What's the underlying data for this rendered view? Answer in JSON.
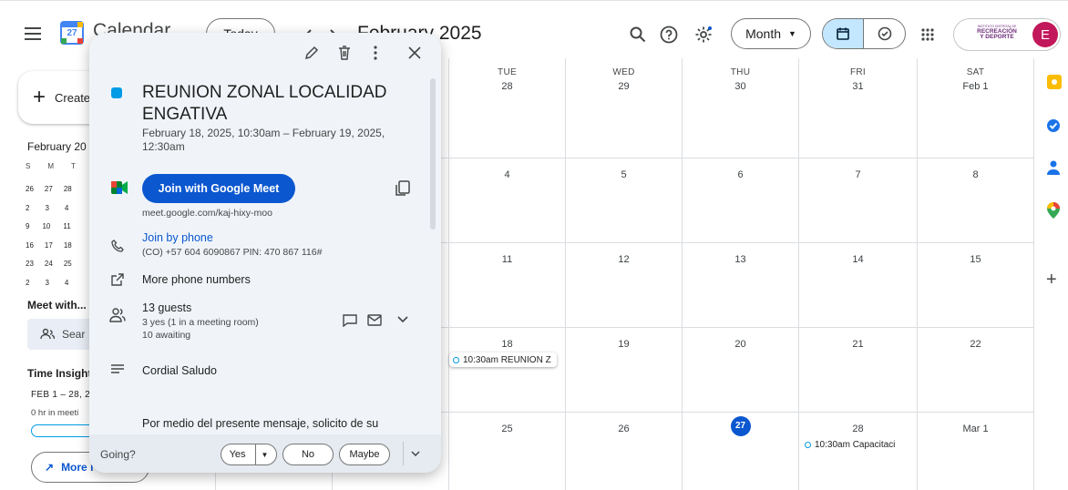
{
  "app": {
    "name": "Calendar",
    "logo_day": "27"
  },
  "header": {
    "today_label": "Today",
    "period_title": "February 2025",
    "view_select": "Month",
    "org_logo_text": [
      "INSTITUTO DISTRITAL DE",
      "RECREACIÓN",
      "Y DEPORTE"
    ],
    "avatar_letter": "E"
  },
  "sidebar": {
    "create_label": "Create",
    "mini_month_title": "February 20",
    "mini_dow": [
      "S",
      "M",
      "T"
    ],
    "mini_rows": [
      [
        "26",
        "27",
        "28"
      ],
      [
        "2",
        "3",
        "4"
      ],
      [
        "9",
        "10",
        "11"
      ],
      [
        "16",
        "17",
        "18"
      ],
      [
        "23",
        "24",
        "25"
      ],
      [
        "2",
        "3",
        "4"
      ]
    ],
    "meet_with_label": "Meet with...",
    "search_people_label": "Sear",
    "time_insights_label": "Time Insight",
    "time_insights_range": "FEB 1 – 28, 2",
    "time_insights_hours": "0 hr in meeti",
    "more_insights_label": "More i"
  },
  "grid": {
    "days": [
      {
        "dow": "TUE",
        "num": "28"
      },
      {
        "dow": "WED",
        "num": "29"
      },
      {
        "dow": "THU",
        "num": "30"
      },
      {
        "dow": "FRI",
        "num": "31"
      },
      {
        "dow": "SAT",
        "num": "Feb 1"
      }
    ],
    "week_rows": [
      [
        "4",
        "5",
        "6",
        "7",
        "8"
      ],
      [
        "11",
        "12",
        "13",
        "14",
        "15"
      ],
      [
        "18",
        "19",
        "20",
        "21",
        "22"
      ],
      [
        "25",
        "26",
        "27",
        "28",
        "Mar 1"
      ]
    ],
    "events": {
      "e18": "10:30am REUNION Z",
      "e28": "10:30am Capacitaci"
    }
  },
  "popup": {
    "title": "REUNION ZONAL LOCALIDAD ENGATIVA",
    "color": "#039be5",
    "datetime": "February 18, 2025, 10:30am – February 19, 2025, 12:30am",
    "join_meet_label": "Join with Google Meet",
    "meet_url": "meet.google.com/kaj-hixy-moo",
    "join_phone_label": "Join by phone",
    "phone_detail": "(CO) +57 604 6090867 PIN: 470 867 116#",
    "more_phones_label": "More phone numbers",
    "guests_count": "13 guests",
    "guests_yes": "3 yes (1 in a meeting room)",
    "guests_awaiting": "10 awaiting",
    "description_line1": "Cordial Saludo",
    "description_line2": "Por medio del presente mensaje, solicito de su",
    "going_label": "Going?",
    "rsvp_yes": "Yes",
    "rsvp_no": "No",
    "rsvp_maybe": "Maybe"
  },
  "colors": {
    "accent": "#0b57d0",
    "event_ring": "#039be5",
    "avatar_bg": "#c2185b"
  }
}
